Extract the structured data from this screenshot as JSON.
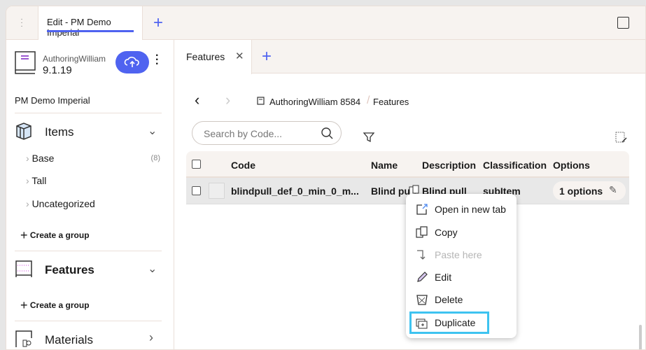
{
  "top_tabs": [
    {
      "label": "Edit - PM Demo Imperial",
      "active": true
    }
  ],
  "library": {
    "owner": "AuthoringWilliam",
    "version": "9.1.19",
    "name": "PM Demo Imperial"
  },
  "sidebar": {
    "items": {
      "title": "Items",
      "groups": [
        {
          "label": "Base",
          "count": "(8)"
        },
        {
          "label": "Tall"
        },
        {
          "label": "Uncategorized"
        }
      ],
      "create": "Create a group"
    },
    "features": {
      "title": "Features",
      "create": "Create a group"
    },
    "materials": {
      "title": "Materials"
    }
  },
  "main": {
    "tab": "Features",
    "breadcrumb": [
      "AuthoringWilliam 8584",
      "Features"
    ],
    "search_placeholder": "Search by Code...",
    "columns": [
      "Code",
      "Name",
      "Description",
      "Classification",
      "Options"
    ],
    "rows": [
      {
        "code": "blindpull_def_0_min_0_m...",
        "name": "Blind pu",
        "description": "Blind pull",
        "classification": "subItem",
        "options": "1 options"
      }
    ]
  },
  "context_menu": [
    {
      "label": "Open in new tab",
      "icon": "external-link-icon"
    },
    {
      "label": "Copy",
      "icon": "copy-icon"
    },
    {
      "label": "Paste here",
      "icon": "paste-icon",
      "disabled": true
    },
    {
      "label": "Edit",
      "icon": "pencil-icon"
    },
    {
      "label": "Delete",
      "icon": "trash-icon"
    },
    {
      "label": "Duplicate",
      "icon": "duplicate-icon",
      "highlighted": true
    }
  ],
  "colors": {
    "accent": "#4f63f0",
    "highlight": "#3ec3f0"
  }
}
